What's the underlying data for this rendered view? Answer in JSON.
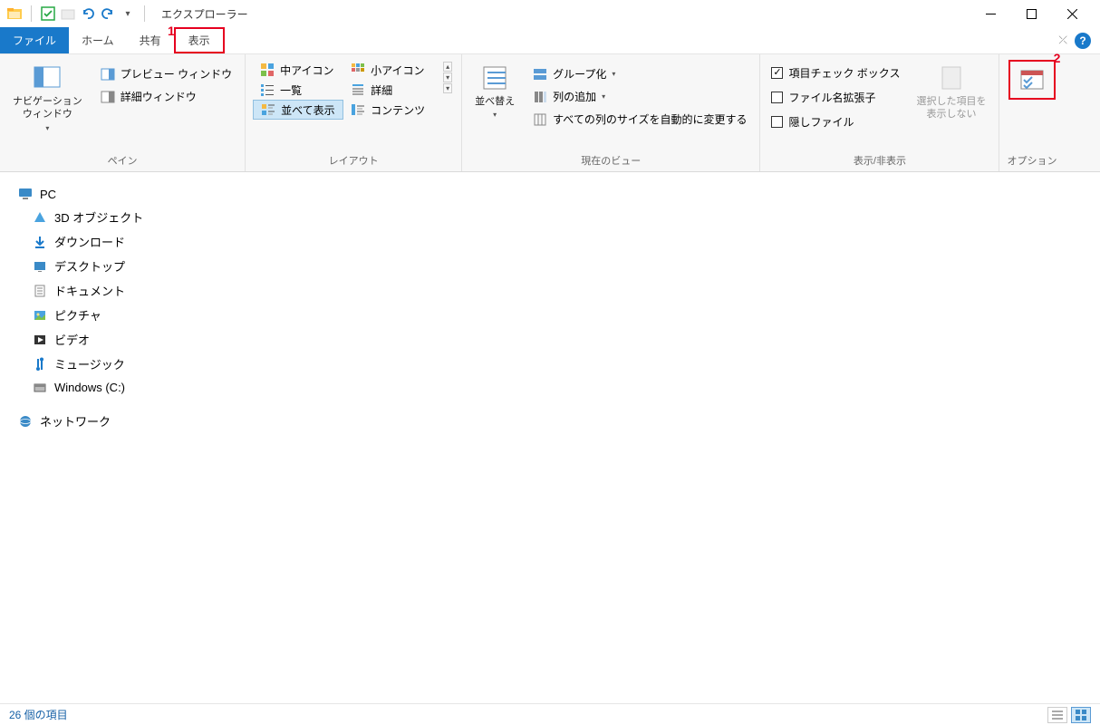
{
  "title": "エクスプローラー",
  "annotations": {
    "num1": "1",
    "num2": "2"
  },
  "tabs": {
    "file": "ファイル",
    "home": "ホーム",
    "share": "共有",
    "view": "表示"
  },
  "ribbon": {
    "panes": {
      "label": "ペイン",
      "nav_pane": "ナビゲーション\nウィンドウ",
      "preview": "プレビュー ウィンドウ",
      "details": "詳細ウィンドウ"
    },
    "layout": {
      "label": "レイアウト",
      "items": [
        "中アイコン",
        "小アイコン",
        "一覧",
        "詳細",
        "並べて表示",
        "コンテンツ"
      ],
      "selected": "並べて表示"
    },
    "currentview": {
      "label": "現在のビュー",
      "sort": "並べ替え",
      "group": "グループ化",
      "addcol": "列の追加",
      "autosize": "すべての列のサイズを自動的に変更する"
    },
    "showhide": {
      "label": "表示/非表示",
      "chk1": "項目チェック ボックス",
      "chk2": "ファイル名拡張子",
      "chk3": "隠しファイル",
      "hidesel": "選択した項目を\n表示しない"
    },
    "options": "オプション"
  },
  "tree": {
    "pc": "PC",
    "items": [
      "3D オブジェクト",
      "ダウンロード",
      "デスクトップ",
      "ドキュメント",
      "ピクチャ",
      "ビデオ",
      "ミュージック",
      "Windows (C:)"
    ],
    "network": "ネットワーク"
  },
  "status": {
    "count": "26 個の項目"
  }
}
